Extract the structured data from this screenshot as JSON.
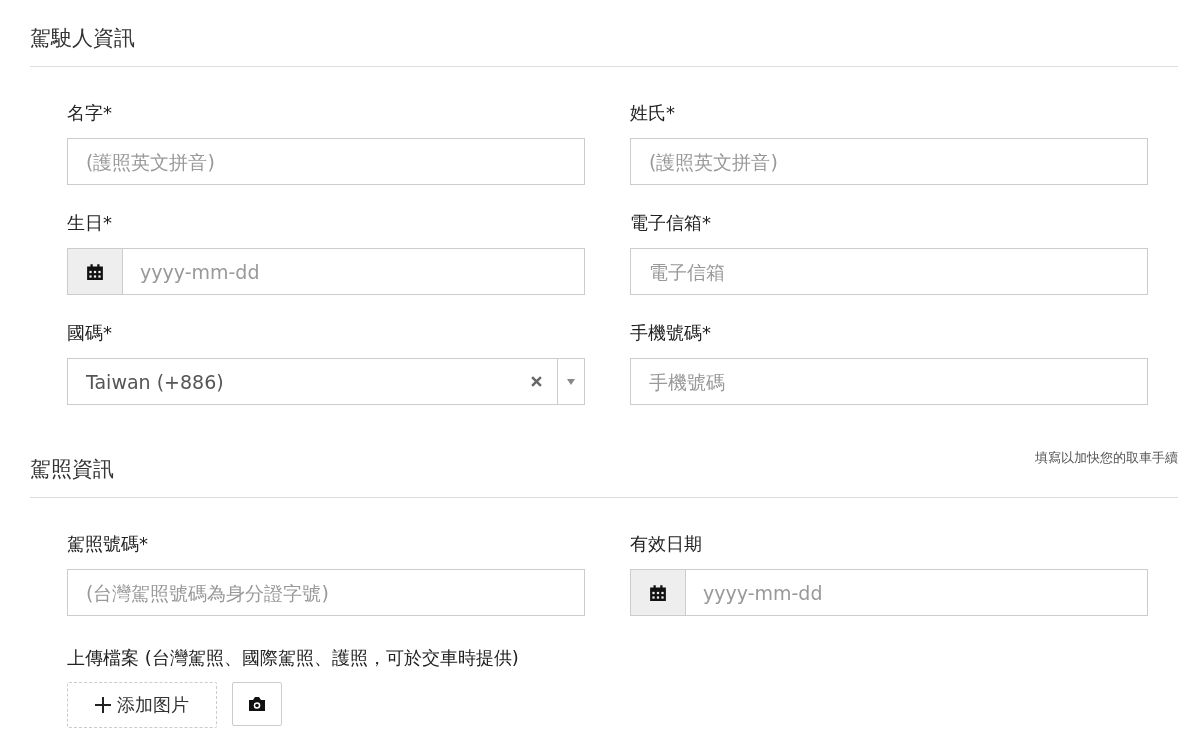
{
  "sections": [
    {
      "title": "駕駛人資訊",
      "fields": [
        {
          "kind": "text",
          "label": "名字*",
          "placeholder": "(護照英文拼音)"
        },
        {
          "kind": "text",
          "label": "姓氏*",
          "placeholder": "(護照英文拼音)"
        },
        {
          "kind": "date",
          "label": "生日*",
          "placeholder": "yyyy-mm-dd"
        },
        {
          "kind": "text",
          "label": "電子信箱*",
          "placeholder": "電子信箱"
        },
        {
          "kind": "select",
          "label": "國碼*",
          "value": "Taiwan (+886)"
        },
        {
          "kind": "text",
          "label": "手機號碼*",
          "placeholder": "手機號碼"
        }
      ]
    },
    {
      "title": "駕照資訊",
      "note": "填寫以加快您的取車手續",
      "fields": [
        {
          "kind": "text",
          "label": "駕照號碼*",
          "placeholder": "(台灣駕照號碼為身分證字號)"
        },
        {
          "kind": "date",
          "label": "有效日期",
          "placeholder": "yyyy-mm-dd"
        }
      ],
      "upload": {
        "label": "上傳檔案 (台灣駕照、國際駕照、護照，可於交車時提供)",
        "add_button": "添加图片"
      }
    }
  ]
}
